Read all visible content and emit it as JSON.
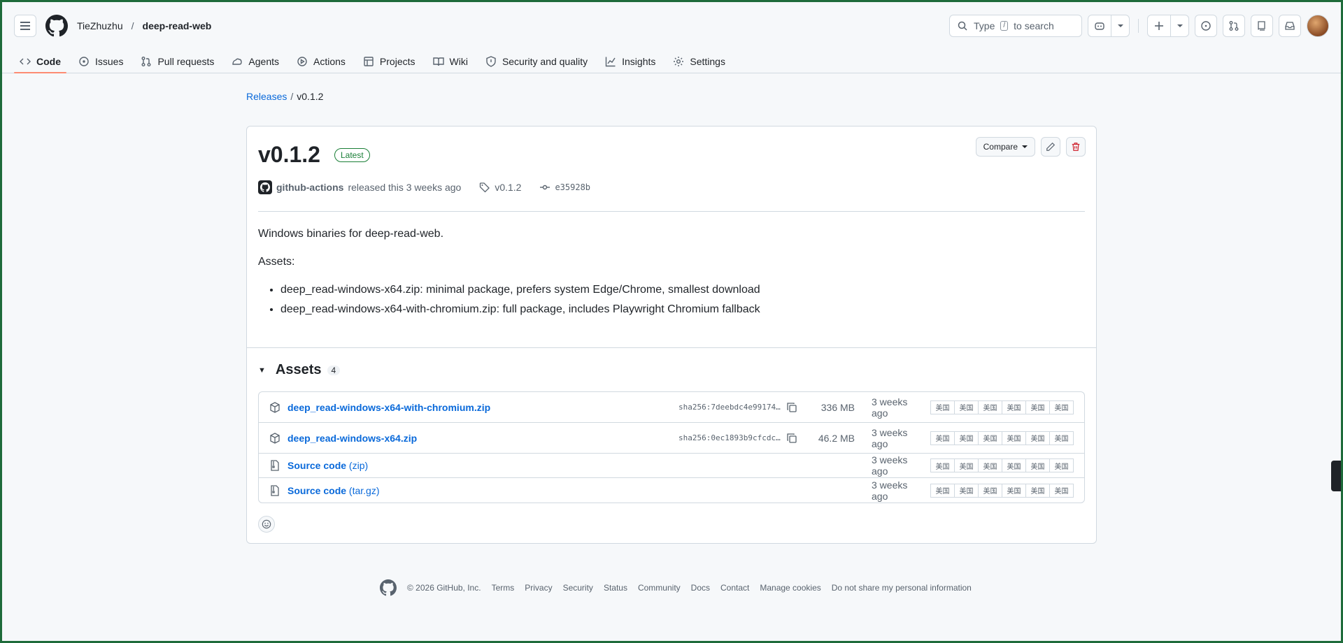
{
  "header": {
    "owner": "TieZhuzhu",
    "separator": "/",
    "repo": "deep-read-web",
    "search_prefix": "Type",
    "search_key": "/",
    "search_suffix": "to search"
  },
  "nav": {
    "tabs": [
      {
        "label": "Code",
        "icon": "code-icon"
      },
      {
        "label": "Issues",
        "icon": "issue-icon"
      },
      {
        "label": "Pull requests",
        "icon": "pull-request-icon"
      },
      {
        "label": "Agents",
        "icon": "agents-icon"
      },
      {
        "label": "Actions",
        "icon": "play-icon"
      },
      {
        "label": "Projects",
        "icon": "table-icon"
      },
      {
        "label": "Wiki",
        "icon": "book-icon"
      },
      {
        "label": "Security and quality",
        "icon": "shield-icon"
      },
      {
        "label": "Insights",
        "icon": "graph-icon"
      },
      {
        "label": "Settings",
        "icon": "gear-icon"
      }
    ]
  },
  "breadcrumb": {
    "releases": "Releases",
    "sep": "/",
    "current": "v0.1.2"
  },
  "release": {
    "title": "v0.1.2",
    "badge": "Latest",
    "compare_label": "Compare",
    "author": "github-actions",
    "released_text": "released this 3 weeks ago",
    "tag": "v0.1.2",
    "commit": "e35928b",
    "description": "Windows binaries for deep-read-web.",
    "assets_heading_text": "Assets:",
    "bullets": [
      "deep_read-windows-x64.zip: minimal package, prefers system Edge/Chrome, smallest download",
      "deep_read-windows-x64-with-chromium.zip: full package, includes Playwright Chromium fallback"
    ]
  },
  "assets": {
    "title": "Assets",
    "count": "4",
    "items": [
      {
        "name": "deep_read-windows-x64-with-chromium.zip",
        "sha": "sha256:7deebdc4e99174…",
        "size": "336 MB",
        "date": "3 weeks ago",
        "flags": [
          "美国",
          "美国",
          "美国",
          "美国",
          "美国",
          "美国"
        ]
      },
      {
        "name": "deep_read-windows-x64.zip",
        "sha": "sha256:0ec1893b9cfcdc…",
        "size": "46.2 MB",
        "date": "3 weeks ago",
        "flags": [
          "美国",
          "美国",
          "美国",
          "美国",
          "美国",
          "美国"
        ]
      },
      {
        "name": "Source code",
        "suffix": "(zip)",
        "date": "3 weeks ago",
        "flags": [
          "美国",
          "美国",
          "美国",
          "美国",
          "美国",
          "美国"
        ]
      },
      {
        "name": "Source code",
        "suffix": "(tar.gz)",
        "date": "3 weeks ago",
        "flags": [
          "美国",
          "美国",
          "美国",
          "美国",
          "美国",
          "美国"
        ]
      }
    ]
  },
  "footer": {
    "copyright": "© 2026 GitHub, Inc.",
    "links": [
      "Terms",
      "Privacy",
      "Security",
      "Status",
      "Community",
      "Docs",
      "Contact",
      "Manage cookies",
      "Do not share my personal information"
    ]
  },
  "colors": {
    "accent": "#0969da",
    "success": "#1a7f37",
    "danger": "#cf222e",
    "underline": "#fd8c73"
  }
}
